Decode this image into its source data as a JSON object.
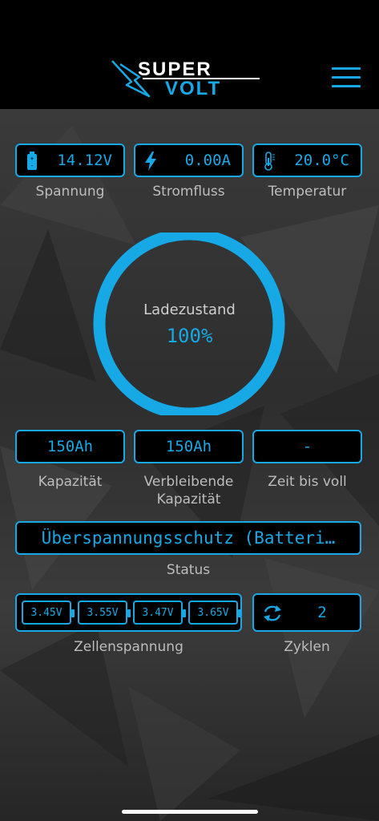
{
  "header": {
    "logo_text_top": "SUPER",
    "logo_text_bottom": "VOLT",
    "menu_icon": "hamburger-menu-icon"
  },
  "metrics": {
    "voltage": {
      "value": "14.12V",
      "label": "Spannung",
      "icon": "battery-icon"
    },
    "current": {
      "value": "0.00A",
      "label": "Stromfluss",
      "icon": "lightning-icon"
    },
    "temperature": {
      "value": "20.0°C",
      "label": "Temperatur",
      "icon": "thermometer-icon"
    }
  },
  "charge": {
    "title": "Ladezustand",
    "value": "100%",
    "fraction": 1.0
  },
  "capacity": {
    "total": {
      "value": "150Ah",
      "label": "Kapazität"
    },
    "remaining": {
      "value": "150Ah",
      "label_line1": "Verbleibende",
      "label_line2": "Kapazität"
    },
    "time_to_full": {
      "value": "-",
      "label": "Zeit bis voll"
    }
  },
  "status": {
    "value": "Überspannungsschutz (Batteri…",
    "label": "Status"
  },
  "cells": {
    "values": [
      "3.45V",
      "3.55V",
      "3.47V",
      "3.65V"
    ],
    "label": "Zellenspannung"
  },
  "cycles": {
    "value": "2",
    "label": "Zyklen",
    "icon": "refresh-cycle-icon"
  },
  "colors": {
    "accent": "#16a9e6",
    "background": "#000000",
    "label": "#bdbdbd"
  }
}
